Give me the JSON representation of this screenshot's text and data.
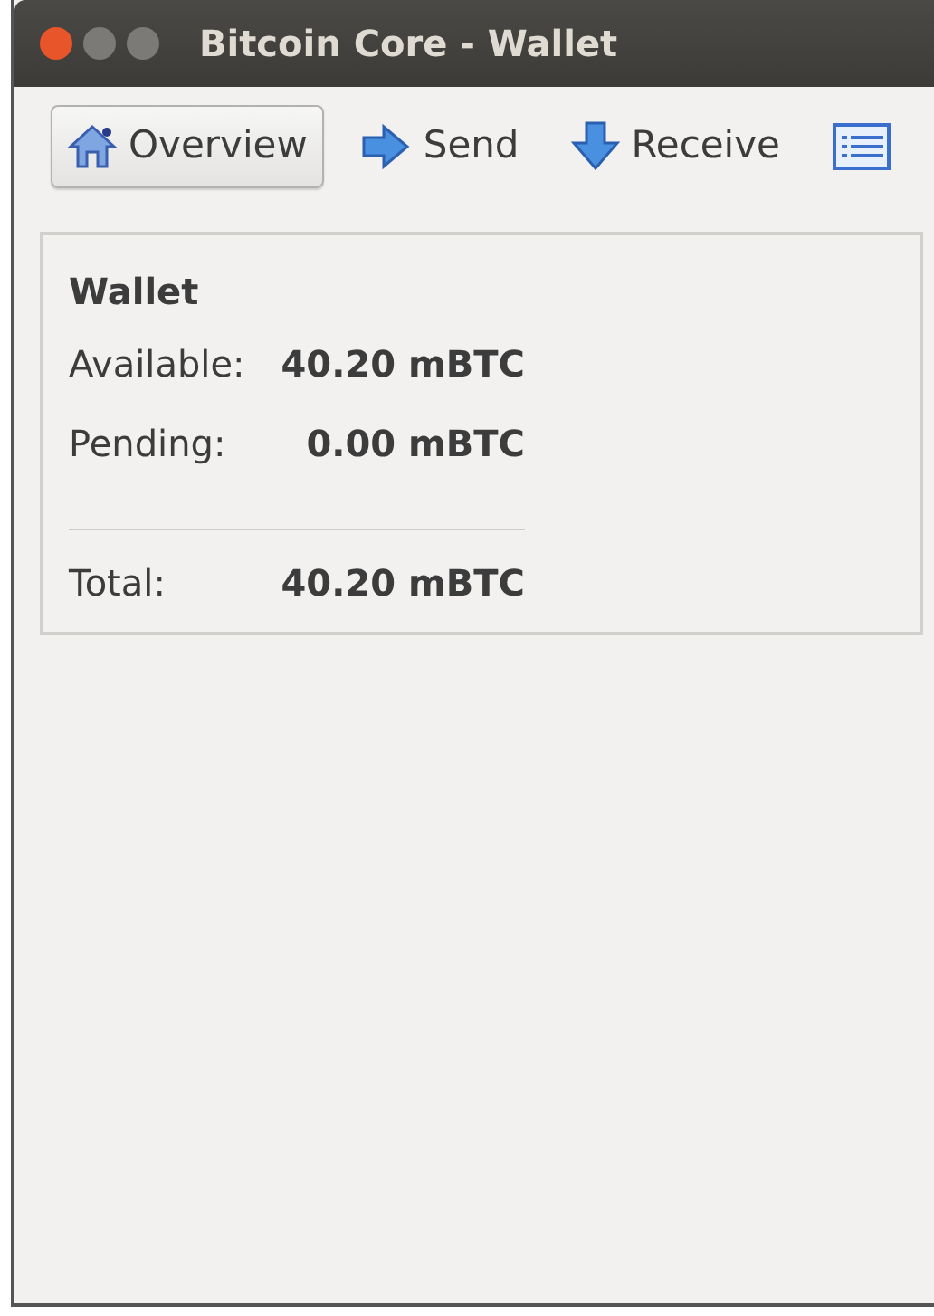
{
  "window": {
    "title": "Bitcoin Core - Wallet"
  },
  "toolbar": [
    {
      "label": "Overview",
      "selected": true
    },
    {
      "label": "Send",
      "selected": false
    },
    {
      "label": "Receive",
      "selected": false
    }
  ],
  "wallet": {
    "heading": "Wallet",
    "rows": [
      {
        "label": "Available:",
        "value": "40.20 mBTC"
      },
      {
        "label": "Pending:",
        "value": "0.00 mBTC"
      },
      {
        "label": "Total:",
        "value": "40.20 mBTC"
      }
    ]
  }
}
